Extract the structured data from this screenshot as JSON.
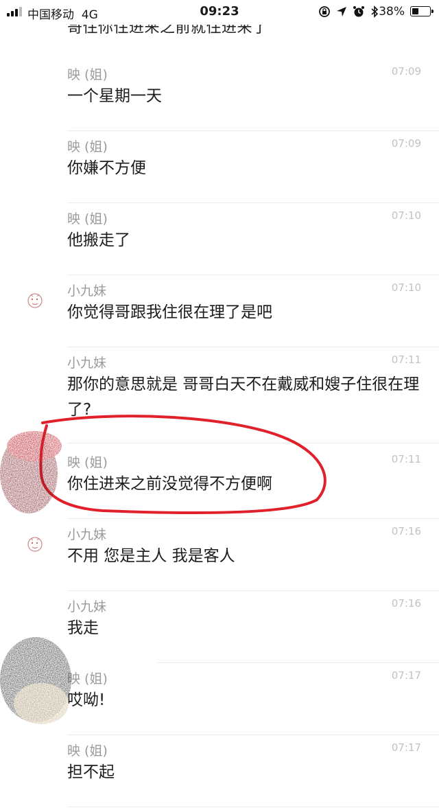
{
  "status_bar": {
    "carrier": "中国移动",
    "network": "4G",
    "time": "09:23",
    "battery_pct": "38%",
    "battery_level": 0.38,
    "icons": [
      "lock-rotation-icon",
      "location-icon",
      "alarm-icon",
      "bluetooth-icon"
    ]
  },
  "clipped_top_text": "哥住你住进来之前就住进来了",
  "messages": [
    {
      "sender": "映 (姐)",
      "time": "07:09",
      "text": "一个星期一天",
      "avatar": false
    },
    {
      "sender": "映 (姐)",
      "time": "07:09",
      "text": "你嫌不方便",
      "avatar": false
    },
    {
      "sender": "映 (姐)",
      "time": "07:10",
      "text": "他搬走了",
      "avatar": false
    },
    {
      "sender": "小九妹",
      "time": "07:10",
      "text": "你觉得哥跟我住很在理了是吧",
      "avatar": true
    },
    {
      "sender": "小九妹",
      "time": "07:11",
      "text": "那你的意思就是 哥哥白天不在戴威和嫂子住很在理了?",
      "avatar": false
    },
    {
      "sender": "映 (姐)",
      "time": "07:11",
      "text": "你住进来之前没觉得不方便啊",
      "avatar": false
    },
    {
      "sender": "小九妹",
      "time": "07:16",
      "text": "不用 您是主人 我是客人",
      "avatar": true
    },
    {
      "sender": "小九妹",
      "time": "07:16",
      "text": "我走",
      "avatar": false
    },
    {
      "sender": "映 (姐)",
      "time": "07:17",
      "text": "哎呦!",
      "avatar": false
    },
    {
      "sender": "映 (姐)",
      "time": "07:17",
      "text": "担不起",
      "avatar": false
    }
  ],
  "colors": {
    "sender": "#9a9a9a",
    "time": "#c2c2c2",
    "highlight_circle": "#e0202a",
    "divider": "#ececec"
  }
}
